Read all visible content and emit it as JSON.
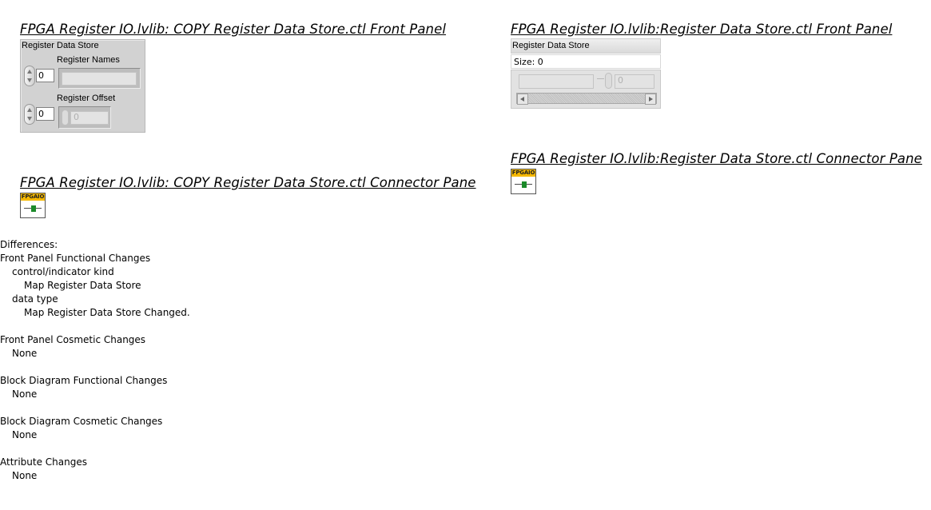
{
  "left": {
    "front_panel_heading": "FPGA Register IO.lvlib:  COPY  Register Data Store.ctl Front Panel",
    "connector_pane_heading": "FPGA Register IO.lvlib:  COPY  Register Data Store.ctl Connector Pane",
    "cluster_label": "Register Data Store",
    "register_names_label": "Register Names",
    "register_names_index": "0",
    "register_offset_label": "Register Offset",
    "register_offset_index": "0",
    "register_offset_value": "0"
  },
  "right": {
    "front_panel_heading": "FPGA Register IO.lvlib:Register Data Store.ctl Front Panel",
    "connector_pane_heading": "FPGA Register IO.lvlib:Register Data Store.ctl Connector Pane",
    "map_label": "Register Data Store",
    "size_text": "Size: 0",
    "value_text": "0"
  },
  "icon": {
    "banner": "FPGAIO",
    "name": "fpga-io-connector-icon"
  },
  "differences": {
    "title": "Differences:",
    "fp_functional": {
      "heading": "Front Panel Functional Changes",
      "item1": "control/indicator kind",
      "item1_detail": "Map Register Data Store",
      "item2": "data type",
      "item2_detail": "Map Register Data Store Changed."
    },
    "fp_cosmetic": {
      "heading": "Front Panel Cosmetic Changes",
      "value": "None"
    },
    "bd_functional": {
      "heading": "Block Diagram Functional Changes",
      "value": "None"
    },
    "bd_cosmetic": {
      "heading": "Block Diagram Cosmetic Changes",
      "value": "None"
    },
    "attribute": {
      "heading": "Attribute Changes",
      "value": "None"
    }
  },
  "colors": {
    "icon_banner": "#f5b800",
    "icon_wire": "#1c8a2a",
    "panel_gray": "#d2d2d2"
  }
}
